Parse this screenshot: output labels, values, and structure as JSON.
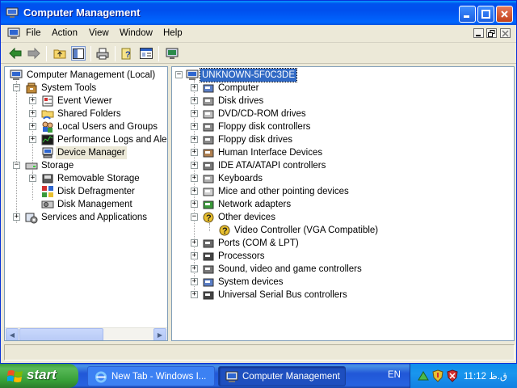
{
  "window": {
    "title": "Computer Management"
  },
  "menubar": {
    "items": [
      "File",
      "Action",
      "View",
      "Window",
      "Help"
    ]
  },
  "toolbar": {
    "icons": [
      "back-icon",
      "forward-icon",
      "up-folder-icon",
      "show-hide-tree-icon",
      "print-icon",
      "help-icon",
      "properties-icon",
      "scan-hardware-icon"
    ]
  },
  "left_tree": {
    "root": "Computer Management (Local)",
    "nodes": [
      {
        "label": "System Tools"
      },
      {
        "label": "Event Viewer"
      },
      {
        "label": "Shared Folders"
      },
      {
        "label": "Local Users and Groups"
      },
      {
        "label": "Performance Logs and Alerts"
      },
      {
        "label": "Device Manager"
      },
      {
        "label": "Storage"
      },
      {
        "label": "Removable Storage"
      },
      {
        "label": "Disk Defragmenter"
      },
      {
        "label": "Disk Management"
      },
      {
        "label": "Services and Applications"
      }
    ]
  },
  "device_tree": {
    "root": "UNKNOWN-5F0C3DE",
    "categories": [
      "Computer",
      "Disk drives",
      "DVD/CD-ROM drives",
      "Floppy disk controllers",
      "Floppy disk drives",
      "Human Interface Devices",
      "IDE ATA/ATAPI controllers",
      "Keyboards",
      "Mice and other pointing devices",
      "Network adapters",
      "Other devices",
      "Video Controller (VGA Compatible)",
      "Ports (COM & LPT)",
      "Processors",
      "Sound, video and game controllers",
      "System devices",
      "Universal Serial Bus controllers"
    ]
  },
  "taskbar": {
    "start": "start",
    "tasks": [
      "New Tab - Windows I...",
      "Computer Management"
    ],
    "language": "EN",
    "clock": "11:12 ق.ظ"
  },
  "colors": {
    "titlebar": "#0054e3",
    "selection": "#316ac5",
    "taskbar": "#245edb",
    "start": "#3c9d3c"
  }
}
